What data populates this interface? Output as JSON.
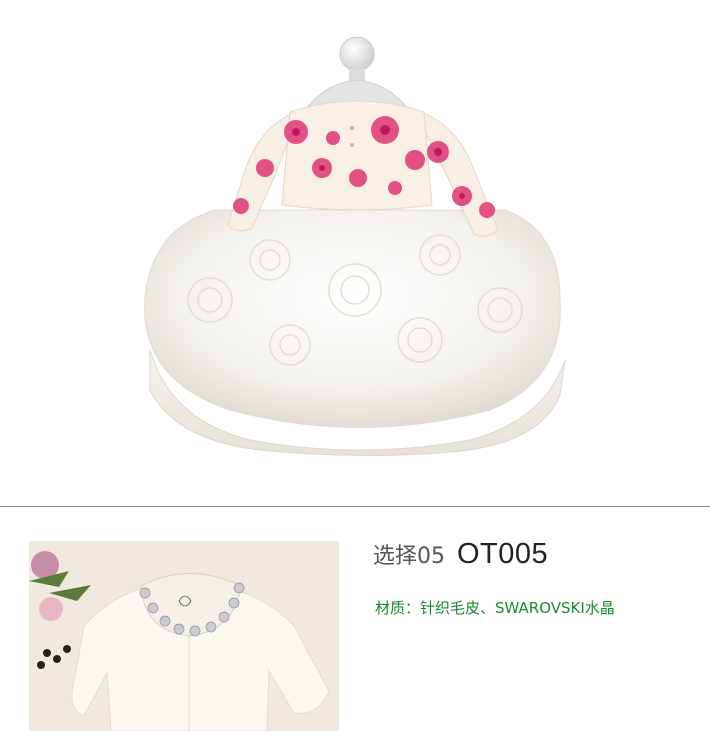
{
  "hero_image": {
    "icon": "dress-photo"
  },
  "thumbnail": {
    "icon": "cardigan-photo"
  },
  "option": {
    "prefix": "选择05",
    "code": "OT005"
  },
  "material": {
    "text": "材质：针织毛皮、SWAROVSKI水晶"
  },
  "colors": {
    "material_text": "#1a8a2c",
    "divider": "#8a8a8a"
  }
}
